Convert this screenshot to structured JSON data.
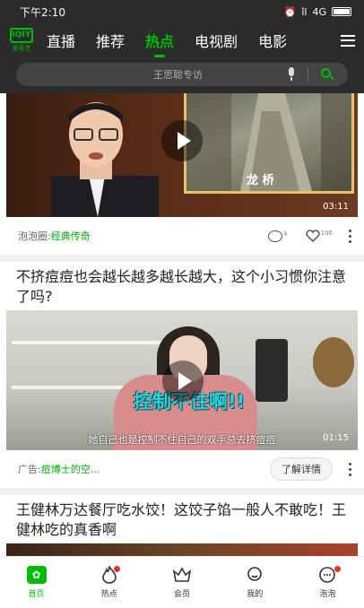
{
  "status_bar": {
    "time": "下午2:10",
    "network": "4G",
    "signal": "ǐl"
  },
  "logo": {
    "text": "iQIY",
    "subtext": "爱奇艺"
  },
  "nav": {
    "tabs": [
      "直播",
      "推荐",
      "热点",
      "电视剧",
      "电影"
    ],
    "active_tab": "热点"
  },
  "search": {
    "placeholder": "王思聪专访"
  },
  "feed": [
    {
      "video_overlay_label": "龙 桥",
      "duration": "03:11",
      "source_prefix": "泡泡圈:",
      "source_name": "经典传奇",
      "comments": "4",
      "likes": "106"
    },
    {
      "title": "不挤痘痘也会越长越多越长越大，这个小习惯你注意了吗?",
      "overlay_text": "控制不住啊!!",
      "caption": "她自己也是控制不住自己的双手总去挤痘痘",
      "duration": "01:15",
      "ad_tag": "广告:",
      "ad_name": "痘博士的空...",
      "cta": "了解详情"
    },
    {
      "title": "王健林万达餐厅吃水饺！这饺子馅一般人不敢吃！王健林吃的真香啊"
    }
  ],
  "bottom_nav": [
    {
      "label": "首页",
      "active": true
    },
    {
      "label": "热点",
      "badge": true
    },
    {
      "label": "会员"
    },
    {
      "label": "我的"
    },
    {
      "label": "泡泡",
      "badge": true
    }
  ],
  "colors": {
    "accent": "#00be06",
    "header_bg": "#2b2b2b",
    "badge": "#e6332a"
  }
}
